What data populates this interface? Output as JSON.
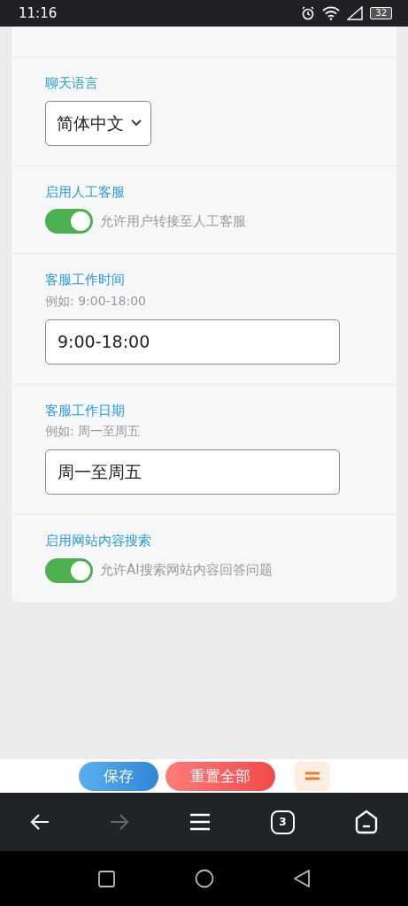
{
  "status_bar": {
    "time": "11:16",
    "battery": "32"
  },
  "settings": [
    {
      "kind": "select",
      "label": "聊天语言",
      "value": "简体中文"
    },
    {
      "kind": "toggle",
      "label": "启用人工客服",
      "on": true,
      "description": "允许用户转接至人工客服"
    },
    {
      "kind": "text",
      "label": "客服工作时间",
      "hint": "例如: 9:00-18:00",
      "value": "9:00-18:00"
    },
    {
      "kind": "text",
      "label": "客服工作日期",
      "hint": "例如: 周一至周五",
      "value": "周一至周五"
    },
    {
      "kind": "toggle",
      "label": "启用网站内容搜索",
      "on": true,
      "description": "允许AI搜索网站内容回答问题"
    }
  ],
  "action_buttons": [
    {
      "kind": "primary",
      "label": "保存"
    },
    {
      "kind": "danger",
      "label": "重置全部"
    },
    {
      "kind": "menu"
    }
  ],
  "browser_toolbar": {
    "tab_count": "3"
  }
}
